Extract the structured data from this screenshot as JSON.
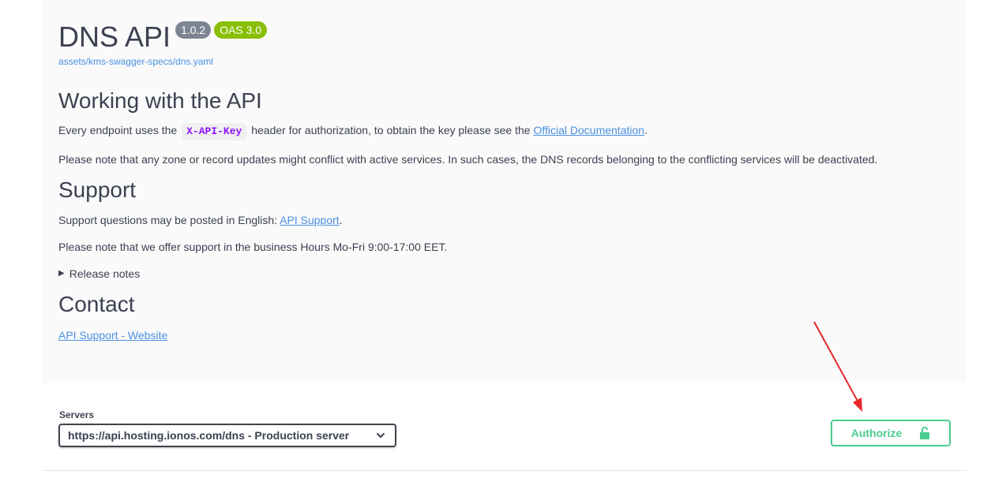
{
  "info": {
    "title": "DNS API",
    "version_badge": "1.0.2",
    "oas_badge": "OAS 3.0",
    "spec_link": "assets/kms-swagger-specs/dns.yaml"
  },
  "working": {
    "heading": "Working with the API",
    "line1_before": "Every endpoint uses the ",
    "line1_code": "X-API-Key",
    "line1_middle": " header for authorization, to obtain the key please see the ",
    "line1_link": "Official Documentation",
    "line1_after": ".",
    "line2": "Please note that any zone or record updates might conflict with active services. In such cases, the DNS records belonging to the conflicting services will be deactivated."
  },
  "support": {
    "heading": "Support",
    "line1_before": "Support questions may be posted in English: ",
    "line1_link": "API Support",
    "line1_after": ".",
    "line2": "Please note that we offer support in the business Hours Mo-Fri 9:00-17:00 EET.",
    "release_notes": "Release notes"
  },
  "contact": {
    "heading": "Contact",
    "link": "API Support - Website"
  },
  "servers": {
    "label": "Servers",
    "selected": "https://api.hosting.ionos.com/dns - Production server"
  },
  "authorize": {
    "label": "Authorize",
    "icon": "unlocked-padlock-icon"
  },
  "colors": {
    "accent_green": "#49cc90",
    "link_blue": "#4990e2",
    "badge_grey": "#7d8492",
    "badge_green": "#89bf04",
    "code_purple": "#9012fe",
    "annotation_arrow": "#e8262b"
  }
}
